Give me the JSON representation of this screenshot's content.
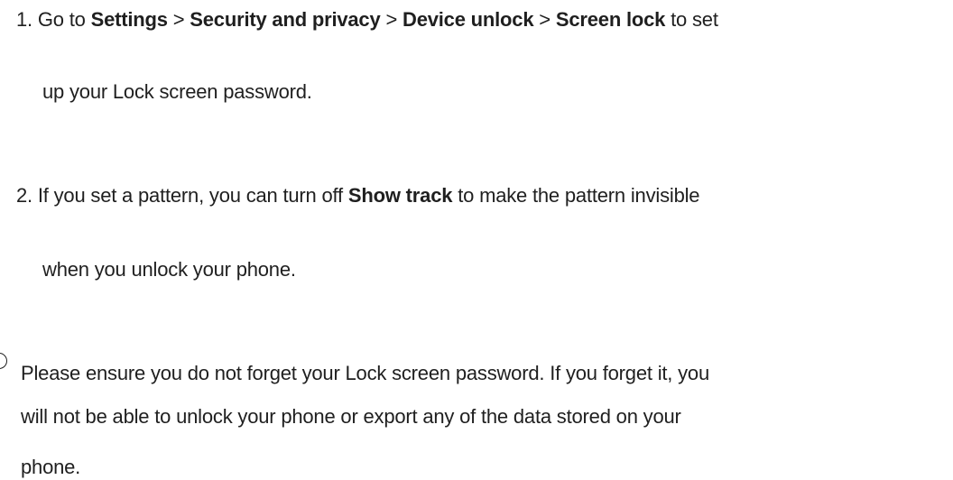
{
  "steps": [
    {
      "number": "1.",
      "go_to": "Go to",
      "settings": "Settings",
      "sep1": ">",
      "security": "Security and privacy",
      "sep2": ">",
      "device_unlock": "Device unlock",
      "sep3": ">",
      "screen_lock": "Screen lock",
      "tail_line1": "to set",
      "line2": "up your Lock screen password."
    },
    {
      "number": "2.",
      "pre": "If you set a pattern, you can turn off",
      "show_track": "Show track",
      "post": "to make the pattern invisible",
      "line2": "when you unlock your phone."
    }
  ],
  "note": {
    "icon": "info-icon",
    "line1": "Please ensure you do not forget your Lock screen password. If you forget it, you",
    "line2": "will not be able to unlock your phone or export any of the data stored on your",
    "line3": "phone."
  }
}
